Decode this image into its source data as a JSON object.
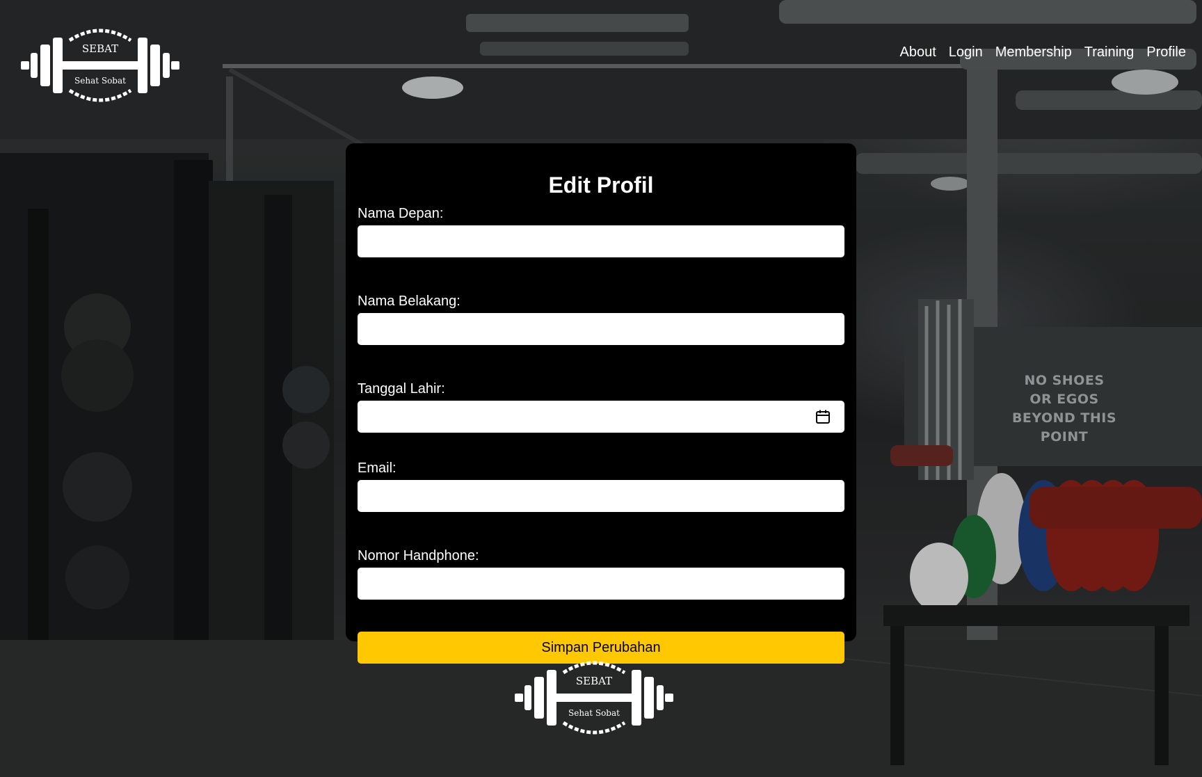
{
  "brand": {
    "logo_top_text": "SEBAT",
    "logo_bottom_text": "Sehat Sobat"
  },
  "nav": {
    "items": [
      "About",
      "Login",
      "Membership",
      "Training",
      "Profile"
    ]
  },
  "form": {
    "title": "Edit Profil",
    "fields": {
      "first_name": {
        "label": "Nama Depan:",
        "value": ""
      },
      "last_name": {
        "label": "Nama Belakang:",
        "value": ""
      },
      "birth_date": {
        "label": "Tanggal Lahir:",
        "value": ""
      },
      "email": {
        "label": "Email:",
        "value": ""
      },
      "phone": {
        "label": "Nomor Handphone:",
        "value": ""
      }
    },
    "submit_label": "Simpan Perubahan",
    "calendar_icon": "calendar-icon"
  },
  "background": {
    "wall_text": [
      "NO SHOES",
      "OR EGOS",
      "BEYOND THIS POINT"
    ]
  },
  "colors": {
    "accent": "#ffc800",
    "card": "#000000",
    "text": "#ffffff"
  }
}
